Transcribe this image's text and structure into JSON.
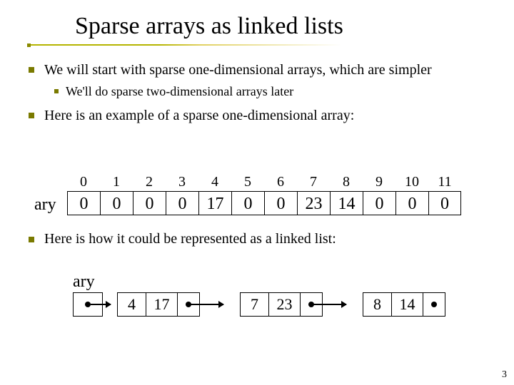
{
  "title": "Sparse arrays as linked lists",
  "bullets": {
    "b1": "We will start with sparse one-dimensional arrays, which are simpler",
    "b1a": "We'll do sparse two-dimensional arrays later",
    "b2": "Here is an example of a sparse one-dimensional array:",
    "b3": "Here is how it could be represented as a linked list:"
  },
  "array": {
    "label": "ary",
    "indices": [
      "0",
      "1",
      "2",
      "3",
      "4",
      "5",
      "6",
      "7",
      "8",
      "9",
      "10",
      "11"
    ],
    "values": [
      "0",
      "0",
      "0",
      "0",
      "17",
      "0",
      "0",
      "23",
      "14",
      "0",
      "0",
      "0"
    ]
  },
  "linked_list": {
    "label": "ary",
    "nodes": [
      {
        "index": "4",
        "value": "17"
      },
      {
        "index": "7",
        "value": "23"
      },
      {
        "index": "8",
        "value": "14"
      }
    ]
  },
  "page_number": "3",
  "chart_data": {
    "type": "table",
    "title": "Sparse one-dimensional array 'ary'",
    "categories": [
      "0",
      "1",
      "2",
      "3",
      "4",
      "5",
      "6",
      "7",
      "8",
      "9",
      "10",
      "11"
    ],
    "values": [
      0,
      0,
      0,
      0,
      17,
      0,
      0,
      23,
      14,
      0,
      0,
      0
    ],
    "linked_list_nodes": [
      {
        "index": 4,
        "value": 17
      },
      {
        "index": 7,
        "value": 23
      },
      {
        "index": 8,
        "value": 14
      }
    ]
  }
}
